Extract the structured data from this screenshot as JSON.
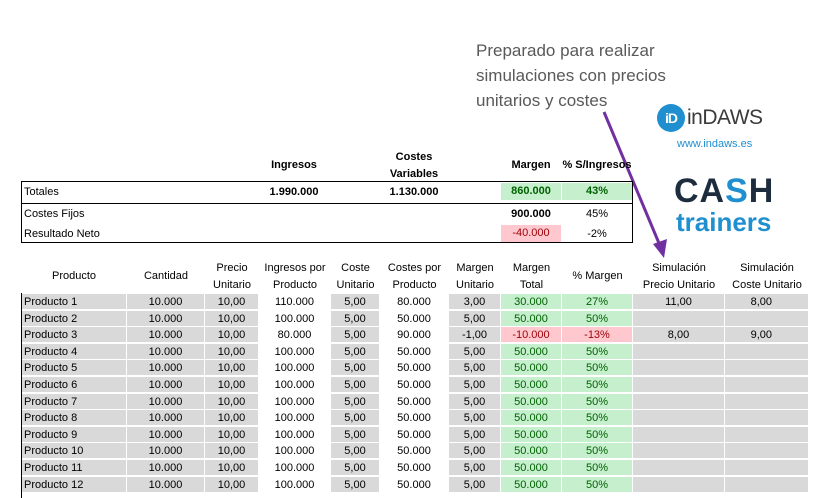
{
  "annotation": {
    "lines": [
      "Preparado para realizar",
      "simulaciones con precios",
      "unitarios y costes"
    ]
  },
  "logos": {
    "indaws_mark": "iD",
    "indaws_name": "inDAWS",
    "indaws_url": "www.indaws.es",
    "cash_left": "CA",
    "cash_mid": "S",
    "cash_right": "H",
    "trainers": "trainers"
  },
  "summary": {
    "headers": {
      "ingresos": "Ingresos",
      "costes_line1": "Costes",
      "costes_line2": "Variables",
      "margen": "Margen",
      "pct": "% S/Ingresos"
    },
    "totales": {
      "label": "Totales",
      "ingresos": "1.990.000",
      "costes": "1.130.000",
      "margen": "860.000",
      "pct": "43%"
    },
    "costes_fijos": {
      "label": "Costes Fijos",
      "margen": "900.000",
      "pct": "45%"
    },
    "resultado": {
      "label": "Resultado Neto",
      "margen": "-40.000",
      "pct": "-2%"
    }
  },
  "table": {
    "columns": [
      [
        "Producto",
        ""
      ],
      [
        "Cantidad",
        ""
      ],
      [
        "Precio",
        "Unitario"
      ],
      [
        "Ingresos por",
        "Producto"
      ],
      [
        "Coste",
        "Unitario"
      ],
      [
        "Costes por",
        "Producto"
      ],
      [
        "Margen",
        "Unitario"
      ],
      [
        "Margen",
        "Total"
      ],
      [
        "% Margen",
        ""
      ],
      [
        "Simulación",
        "Precio Unitario"
      ],
      [
        "Simulación",
        "Coste Unitario"
      ]
    ],
    "rows": [
      [
        "Producto 1",
        "10.000",
        "10,00",
        "110.000",
        "5,00",
        "80.000",
        "3,00",
        "30.000",
        "27%",
        "11,00",
        "8,00"
      ],
      [
        "Producto 2",
        "10.000",
        "10,00",
        "100.000",
        "5,00",
        "50.000",
        "5,00",
        "50.000",
        "50%",
        "",
        ""
      ],
      [
        "Producto 3",
        "10.000",
        "10,00",
        "80.000",
        "5,00",
        "90.000",
        "-1,00",
        "-10.000",
        "-13%",
        "8,00",
        "9,00"
      ],
      [
        "Producto 4",
        "10.000",
        "10,00",
        "100.000",
        "5,00",
        "50.000",
        "5,00",
        "50.000",
        "50%",
        "",
        ""
      ],
      [
        "Producto 5",
        "10.000",
        "10,00",
        "100.000",
        "5,00",
        "50.000",
        "5,00",
        "50.000",
        "50%",
        "",
        ""
      ],
      [
        "Producto 6",
        "10.000",
        "10,00",
        "100.000",
        "5,00",
        "50.000",
        "5,00",
        "50.000",
        "50%",
        "",
        ""
      ],
      [
        "Producto 7",
        "10.000",
        "10,00",
        "100.000",
        "5,00",
        "50.000",
        "5,00",
        "50.000",
        "50%",
        "",
        ""
      ],
      [
        "Producto 8",
        "10.000",
        "10,00",
        "100.000",
        "5,00",
        "50.000",
        "5,00",
        "50.000",
        "50%",
        "",
        ""
      ],
      [
        "Producto 9",
        "10.000",
        "10,00",
        "100.000",
        "5,00",
        "50.000",
        "5,00",
        "50.000",
        "50%",
        "",
        ""
      ],
      [
        "Producto 10",
        "10.000",
        "10,00",
        "100.000",
        "5,00",
        "50.000",
        "5,00",
        "50.000",
        "50%",
        "",
        ""
      ],
      [
        "Producto 11",
        "10.000",
        "10,00",
        "100.000",
        "5,00",
        "50.000",
        "5,00",
        "50.000",
        "50%",
        "",
        ""
      ],
      [
        "Producto 12",
        "10.000",
        "10,00",
        "100.000",
        "5,00",
        "50.000",
        "5,00",
        "50.000",
        "50%",
        "",
        ""
      ]
    ],
    "negative_row_index": 2
  },
  "colors": {
    "positive_fill": "#c6efce",
    "positive_text": "#006100",
    "negative_fill": "#ffc7ce",
    "negative_text": "#9c0006",
    "row_fill": "#d9d9d9",
    "arrow": "#7030a0",
    "brand_blue": "#1f8fd0"
  }
}
